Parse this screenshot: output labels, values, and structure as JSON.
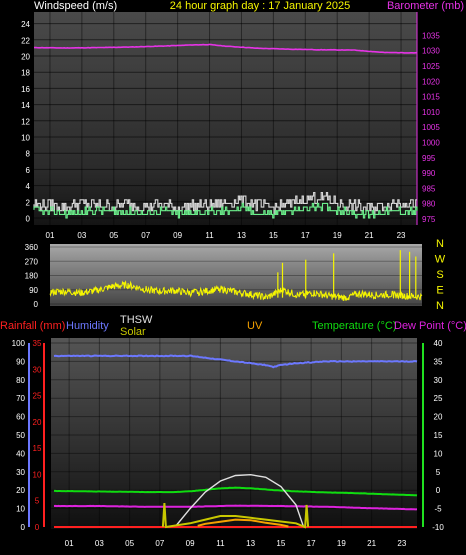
{
  "header": {
    "left_label": "Windspeed (m/s)",
    "center_label": "24 hour graph day : 17 January 2025",
    "right_label": "Barometer (mb)"
  },
  "colors": {
    "wind_avg": "#6CF08C",
    "wind_gust": "#D8D8D8",
    "barometer": "#E633E6",
    "direction": "#F5F500",
    "rain": "#FF2020",
    "humidity": "#6C78FF",
    "thsw": "#E0E0E0",
    "solar": "#C8C800",
    "uv": "#F5A200",
    "temperature": "#10DC10",
    "dew_point": "#DD22DD",
    "axis_green": "#20E020"
  },
  "chart_data": [
    {
      "type": "line",
      "title": "24 hour graph day : 17 January 2025",
      "xlabel": "",
      "x_ticks": [
        "01",
        "03",
        "05",
        "07",
        "09",
        "11",
        "13",
        "15",
        "17",
        "19",
        "21",
        "23"
      ],
      "xlim": [
        0,
        24
      ],
      "left_axis": {
        "label": "Windspeed (m/s)",
        "ticks": [
          0,
          2,
          4,
          6,
          8,
          10,
          12,
          14,
          16,
          18,
          20,
          22,
          24
        ],
        "ylim": [
          0,
          25.2
        ]
      },
      "right_axis": {
        "label": "Barometer (mb)",
        "ticks": [
          975,
          980,
          985,
          990,
          995,
          1000,
          1005,
          1010,
          1015,
          1020,
          1025,
          1030,
          1035
        ],
        "ylim": [
          974,
          1037
        ]
      },
      "series": [
        {
          "name": "Barometer (mb)",
          "axis": "right",
          "color": "#E633E6",
          "x": [
            0,
            2,
            4,
            6,
            8,
            10,
            11,
            12,
            14,
            16,
            18,
            20,
            21.5,
            22,
            24
          ],
          "values": [
            1031.0,
            1030.9,
            1031.0,
            1031.2,
            1031.5,
            1031.9,
            1032.0,
            1031.5,
            1030.8,
            1030.5,
            1030.3,
            1030.2,
            1029.6,
            1029.4,
            1029.3
          ]
        },
        {
          "name": "Windspeed (m/s)",
          "axis": "left",
          "color": "#6CF08C",
          "x": [
            0,
            1,
            2,
            3,
            4,
            5,
            6,
            7,
            8,
            9,
            10,
            11,
            12,
            13,
            14,
            15,
            16,
            17,
            18,
            19,
            20,
            21,
            22,
            23,
            24
          ],
          "values": [
            1.0,
            0.8,
            0.5,
            0.8,
            1.0,
            0.7,
            0.8,
            0.6,
            0.9,
            0.5,
            0.7,
            0.8,
            0.9,
            1.2,
            0.6,
            0.5,
            0.8,
            1.2,
            1.5,
            1.0,
            0.6,
            0.4,
            0.7,
            0.9,
            0.8
          ]
        },
        {
          "name": "Wind gust",
          "axis": "left",
          "color": "#D8D8D8",
          "x": [
            0,
            1,
            2,
            3,
            4,
            5,
            6,
            7,
            8,
            9,
            10,
            11,
            12,
            13,
            14,
            15,
            16,
            17,
            18,
            19,
            20,
            21,
            22,
            23,
            24
          ],
          "values": [
            1.7,
            1.5,
            1.4,
            1.8,
            1.6,
            1.5,
            1.7,
            1.4,
            1.6,
            1.3,
            1.5,
            1.6,
            1.8,
            2.2,
            1.5,
            1.3,
            1.7,
            2.4,
            2.6,
            1.9,
            1.4,
            1.2,
            1.6,
            2.0,
            1.7
          ]
        }
      ]
    },
    {
      "type": "line",
      "title": "",
      "x_ticks": [
        "01",
        "03",
        "05",
        "07",
        "09",
        "11",
        "13",
        "15",
        "17",
        "19",
        "21",
        "23"
      ],
      "xlim": [
        0,
        24
      ],
      "left_axis": {
        "label": "",
        "ticks": [
          0,
          90,
          180,
          270,
          360
        ],
        "ylim": [
          0,
          380
        ]
      },
      "right_axis": {
        "label": "",
        "ticks": [
          "N",
          "W",
          "S",
          "E",
          "N"
        ]
      },
      "series": [
        {
          "name": "Wind direction",
          "axis": "left",
          "color": "#F5F500",
          "x": [
            0,
            1,
            2,
            3,
            4,
            5,
            6,
            7,
            8,
            9,
            10,
            11,
            12,
            13,
            14,
            15,
            16,
            17,
            18,
            19,
            20,
            21,
            22,
            23,
            24
          ],
          "values": [
            75,
            80,
            70,
            85,
            110,
            120,
            95,
            80,
            85,
            70,
            80,
            95,
            75,
            60,
            40,
            90,
            55,
            70,
            50,
            40,
            65,
            55,
            60,
            50,
            45
          ]
        }
      ],
      "spikes_x": [
        14.7,
        15.0,
        16.5,
        18.3,
        22.6,
        23.2,
        23.6
      ],
      "spikes_values": [
        200,
        260,
        280,
        320,
        340,
        330,
        300
      ]
    },
    {
      "type": "line",
      "title": "",
      "x_ticks": [
        "01",
        "03",
        "05",
        "07",
        "09",
        "11",
        "13",
        "15",
        "17",
        "19",
        "21",
        "23"
      ],
      "xlim": [
        0,
        24
      ],
      "legend": [
        "Rainfall (mm)",
        "Humidity",
        "THSW",
        "Solar",
        "UV",
        "Temperature (°C)",
        "Dew Point (°C)"
      ],
      "axes": {
        "humidity": {
          "label": "Humidity",
          "ticks": [
            0,
            10,
            20,
            30,
            40,
            50,
            60,
            70,
            80,
            90,
            100
          ],
          "ylim": [
            0,
            100
          ]
        },
        "rainfall": {
          "label": "Rainfall (mm)",
          "ticks": [
            0,
            5,
            10,
            15,
            20,
            25,
            30,
            35
          ],
          "ylim": [
            0,
            35
          ]
        },
        "temperature": {
          "label": "Temperature (°C)",
          "ticks": [
            -10,
            -5,
            0,
            5,
            10,
            15,
            20,
            25,
            30,
            35,
            40
          ],
          "ylim": [
            -10,
            40
          ]
        }
      },
      "series": [
        {
          "name": "Humidity",
          "axis": "humidity",
          "color": "#6C78FF",
          "x": [
            0,
            3,
            6,
            9,
            10,
            11,
            12,
            13,
            14,
            14.5,
            15,
            16,
            18,
            20,
            22,
            24
          ],
          "values": [
            93,
            93,
            93,
            93,
            92,
            91,
            90,
            89,
            88,
            87,
            88,
            89,
            90,
            90,
            90,
            90
          ]
        },
        {
          "name": "Temperature (°C)",
          "axis": "temperature",
          "color": "#10DC10",
          "x": [
            0,
            2,
            4,
            6,
            8,
            9,
            10,
            11,
            12,
            13,
            14,
            15,
            16,
            18,
            20,
            22,
            24
          ],
          "values": [
            -0.2,
            -0.3,
            -0.4,
            -0.5,
            -0.5,
            -0.3,
            0.1,
            0.5,
            0.7,
            0.5,
            0.2,
            -0.1,
            -0.3,
            -0.6,
            -0.8,
            -1.1,
            -1.4
          ]
        },
        {
          "name": "Dew Point (°C)",
          "axis": "temperature",
          "color": "#DD22DD",
          "x": [
            0,
            3,
            6,
            9,
            12,
            15,
            18,
            21,
            24
          ],
          "values": [
            -4.3,
            -4.3,
            -4.5,
            -4.5,
            -4.2,
            -4.3,
            -4.5,
            -4.9,
            -5.2
          ]
        },
        {
          "name": "THSW",
          "axis": "temperature",
          "color": "#E0E0E0",
          "x": [
            8.0,
            9,
            10,
            11,
            12,
            13,
            14,
            15,
            16,
            16.5
          ],
          "values": [
            -10,
            -5,
            -0.5,
            2.5,
            4.0,
            4.2,
            3.5,
            1.0,
            -4.0,
            -10
          ]
        },
        {
          "name": "Rainfall (mm)",
          "axis": "rainfall",
          "color": "#FF2020",
          "x": [
            0,
            24
          ],
          "values": [
            0,
            0
          ]
        },
        {
          "name": "Solar",
          "axis": "humidity",
          "color": "#C8C800",
          "x": [
            7.2,
            7.3,
            7.4,
            9.0,
            10,
            11,
            12,
            13,
            14,
            15,
            16,
            16.6,
            16.7,
            16.8
          ],
          "values": [
            0,
            13,
            0,
            2,
            4,
            6,
            6,
            5,
            4,
            3,
            2,
            0,
            12,
            0
          ]
        },
        {
          "name": "UV",
          "axis": "rainfall",
          "color": "#F5A200",
          "x": [
            9.5,
            10,
            11,
            12,
            13,
            14,
            15,
            15.5
          ],
          "values": [
            0.2,
            0.6,
            1.0,
            1.4,
            1.3,
            0.8,
            0.4,
            0.1
          ]
        }
      ]
    }
  ]
}
